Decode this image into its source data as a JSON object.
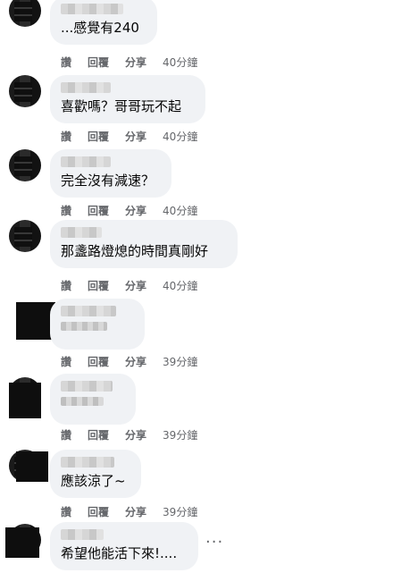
{
  "comments": [
    {
      "text": "...感覺有240",
      "actions": {
        "like": "讚",
        "reply": "回覆",
        "share": "分享",
        "time": "40分鐘"
      }
    },
    {
      "text": "喜歡嗎？哥哥玩不起",
      "actions": {
        "like": "讚",
        "reply": "回覆",
        "share": "分享",
        "time": "40分鐘"
      }
    },
    {
      "text": "完全沒有減速？",
      "actions": {
        "like": "讚",
        "reply": "回覆",
        "share": "分享",
        "time": "40分鐘"
      }
    },
    {
      "text": "那盞路燈熄的時間真剛好",
      "actions": {
        "like": "讚",
        "reply": "回覆",
        "share": "分享",
        "time": "40分鐘"
      }
    },
    {
      "text": "",
      "actions": {
        "like": "讚",
        "reply": "回覆",
        "share": "分享",
        "time": "39分鐘"
      }
    },
    {
      "text": "",
      "actions": {
        "like": "讚",
        "reply": "回覆",
        "share": "分享",
        "time": "39分鐘"
      }
    },
    {
      "text": "應該涼了~",
      "actions": {
        "like": "讚",
        "reply": "回覆",
        "share": "分享",
        "time": "39分鐘"
      }
    },
    {
      "text": "希望他能活下來!....",
      "more": "···"
    }
  ]
}
